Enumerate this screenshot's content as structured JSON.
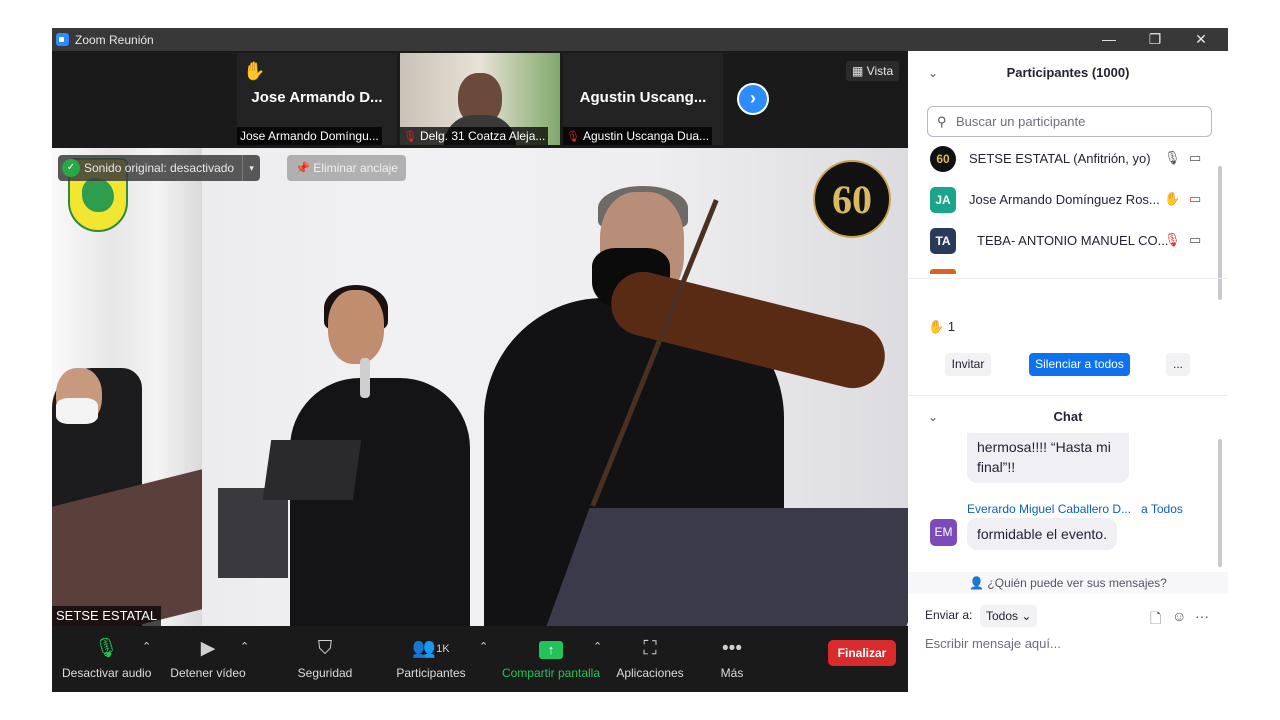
{
  "window": {
    "title": "Zoom Reunión",
    "controls": {
      "minimize": "—",
      "restore": "❐",
      "close": "✕"
    }
  },
  "thumbnails": [
    {
      "display_name": "Jose Armando D...",
      "label": "Jose Armando Domíngu...",
      "hand_raised": true,
      "muted": false
    },
    {
      "display_name": "",
      "label": "Delg. 31 Coatza Aleja...",
      "hand_raised": false,
      "muted": true,
      "video_on": true
    },
    {
      "display_name": "Agustin Uscang...",
      "label": "Agustin Uscanga Dua...",
      "hand_raised": false,
      "muted": true
    }
  ],
  "view_button": "Vista",
  "main_video": {
    "speaker_label": "SETSE ESTATAL",
    "original_sound": "Sonido original: desactivado",
    "unpin": "Eliminar anclaje",
    "badge_number": "60"
  },
  "toolbar": {
    "mute": "Desactivar audio",
    "video": "Detener vídeo",
    "security": "Seguridad",
    "participants": "Participantes",
    "participants_count": "1K",
    "share": "Compartir pantalla",
    "apps": "Aplicaciones",
    "more": "Más",
    "end": "Finalizar"
  },
  "participants_panel": {
    "title": "Participantes (1000)",
    "search_placeholder": "Buscar un participante",
    "rows": [
      {
        "avatar": "60",
        "name": "SETSE ESTATAL (Anfitrión, yo)",
        "color": "#111111"
      },
      {
        "avatar": "JA",
        "name": "Jose Armando Domínguez Ros...",
        "color": "#1aa58a"
      },
      {
        "avatar": "TA",
        "name": "TEBA- ANTONIO MANUEL CO...",
        "color": "#2a3a5a"
      }
    ],
    "raised_hands": "1",
    "invite": "Invitar",
    "mute_all": "Silenciar a todos",
    "more": "..."
  },
  "chat": {
    "title": "Chat",
    "messages": [
      {
        "text": "hermosa!!!! “Hasta mi final”!!"
      },
      {
        "sender": "Everardo Miguel Caballero D...",
        "recipient": "a Todos",
        "avatar": "EM",
        "text": "formidable el evento."
      }
    ],
    "who_can_see": "¿Quién puede ver sus mensajes?",
    "send_to_label": "Enviar a:",
    "send_to_value": "Todos",
    "input_placeholder": "Escribir mensaje aquí..."
  },
  "colors": {
    "accent": "#0e72ed",
    "end_button": "#d92b2b",
    "share_green": "#22c35a",
    "mic_green": "#22c35a"
  }
}
